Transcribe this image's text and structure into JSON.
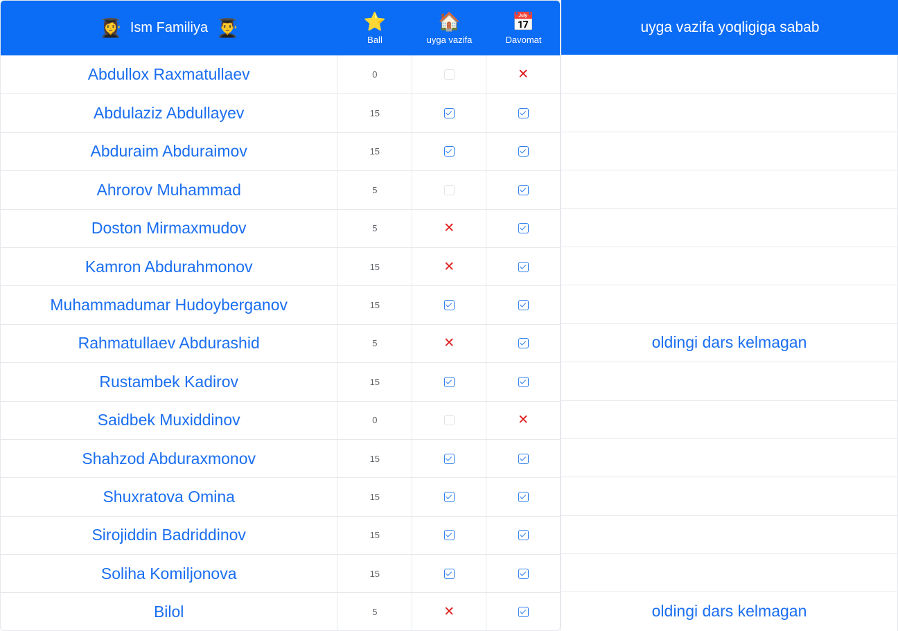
{
  "header": {
    "name_label": "Ism Familiya",
    "name_left_emoji": "👩‍🎓",
    "name_right_emoji": "👨‍🎓",
    "ball_label": "Ball",
    "ball_icon": "⭐",
    "homework_label": "uyga vazifa",
    "homework_icon": "🏠",
    "attendance_label": "Davomat",
    "attendance_icon": "📅",
    "reason_label": "uyga vazifa yoqligiga sabab"
  },
  "colors": {
    "header_bg": "#0b6cf5",
    "name_text": "#1a6ef0",
    "cross": "#e01b1b",
    "check": "#2f80ed"
  },
  "students": [
    {
      "name": "Abdullox Raxmatullaev",
      "ball": "0",
      "homework": "empty",
      "attendance": "cross",
      "reason": ""
    },
    {
      "name": "Abdulaziz Abdullayev",
      "ball": "15",
      "homework": "check",
      "attendance": "check",
      "reason": ""
    },
    {
      "name": "Abduraim Abduraimov",
      "ball": "15",
      "homework": "check",
      "attendance": "check",
      "reason": ""
    },
    {
      "name": "Ahrorov Muhammad",
      "ball": "5",
      "homework": "empty",
      "attendance": "check",
      "reason": ""
    },
    {
      "name": "Doston Mirmaxmudov",
      "ball": "5",
      "homework": "cross",
      "attendance": "check",
      "reason": ""
    },
    {
      "name": "Kamron Abdurahmonov",
      "ball": "15",
      "homework": "cross",
      "attendance": "check",
      "reason": ""
    },
    {
      "name": "Muhammadumar Hudoyberganov",
      "ball": "15",
      "homework": "check",
      "attendance": "check",
      "reason": ""
    },
    {
      "name": "Rahmatullaev Abdurashid",
      "ball": "5",
      "homework": "cross",
      "attendance": "check",
      "reason": "oldingi dars kelmagan"
    },
    {
      "name": "Rustambek Kadirov",
      "ball": "15",
      "homework": "check",
      "attendance": "check",
      "reason": ""
    },
    {
      "name": "Saidbek Muxiddinov",
      "ball": "0",
      "homework": "empty",
      "attendance": "cross",
      "reason": ""
    },
    {
      "name": "Shahzod Abduraxmonov",
      "ball": "15",
      "homework": "check",
      "attendance": "check",
      "reason": ""
    },
    {
      "name": "Shuxratova Omina",
      "ball": "15",
      "homework": "check",
      "attendance": "check",
      "reason": ""
    },
    {
      "name": "Sirojiddin Badriddinov",
      "ball": "15",
      "homework": "check",
      "attendance": "check",
      "reason": ""
    },
    {
      "name": "Soliha Komiljonova",
      "ball": "15",
      "homework": "check",
      "attendance": "check",
      "reason": ""
    },
    {
      "name": "Bilol",
      "ball": "5",
      "homework": "cross",
      "attendance": "check",
      "reason": "oldingi dars kelmagan"
    }
  ]
}
